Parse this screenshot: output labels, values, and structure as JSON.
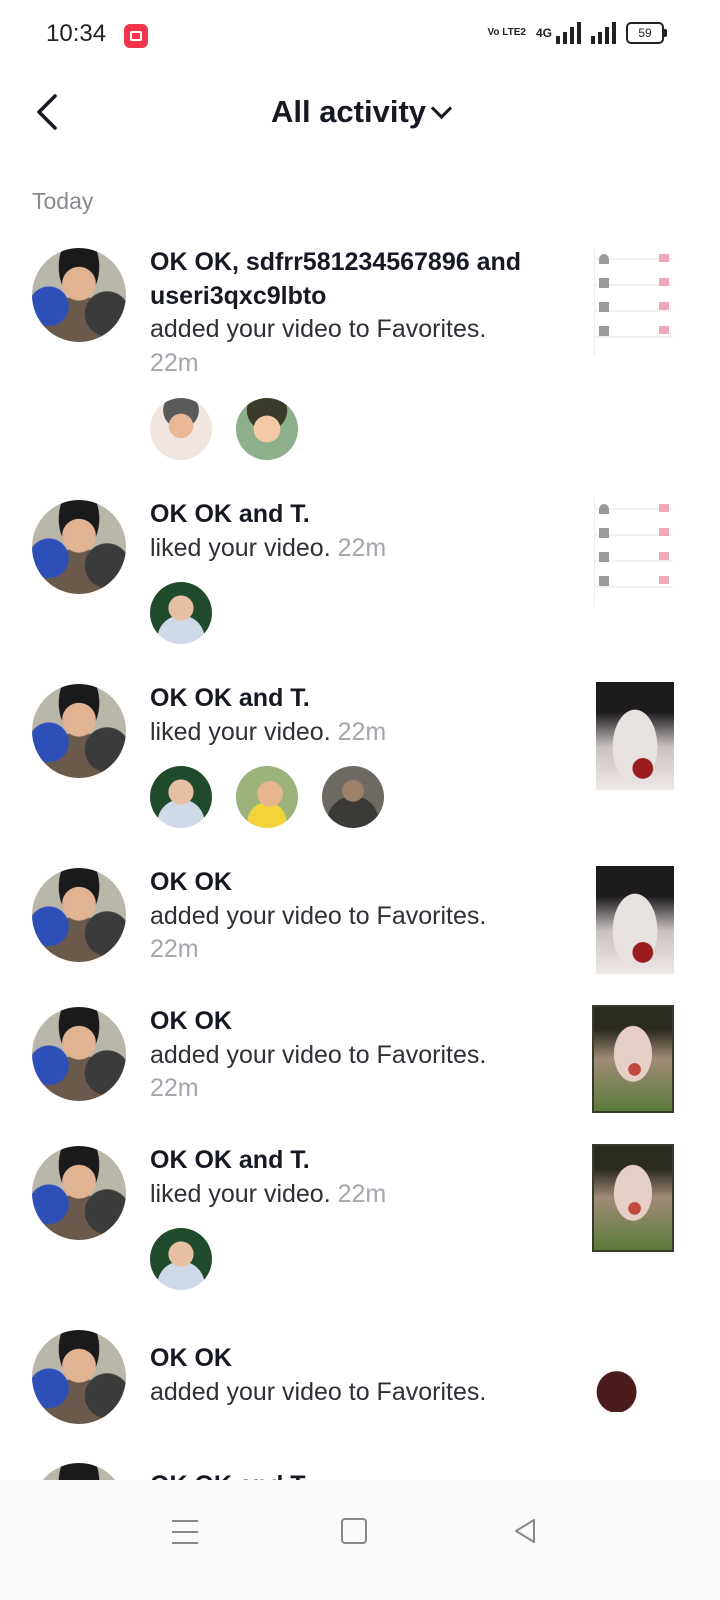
{
  "status_bar": {
    "time": "10:34",
    "volte": "Vo LTE2",
    "network": "4G",
    "battery": "59",
    "icons": [
      "screen-record-icon",
      "volte-icon",
      "signal-icon",
      "signal-icon",
      "battery-icon"
    ]
  },
  "header": {
    "title": "All activity",
    "back_icon": "chevron-left-icon",
    "dropdown_icon": "chevron-down-icon"
  },
  "section": {
    "label": "Today"
  },
  "notifications": [
    {
      "names": "OK OK, sdfrr581234567896 and useri3qxc9lbto",
      "action": "added your video to Favorites.",
      "time": "22m",
      "time_inline": false
    },
    {
      "names": "OK OK and T.",
      "action": "liked your video.",
      "time": "22m",
      "time_inline": true
    },
    {
      "names": "OK OK and T.",
      "action": "liked your video.",
      "time": "22m",
      "time_inline": true
    },
    {
      "names": "OK OK",
      "action": "added your video to Favorites.",
      "time": "22m",
      "time_inline": false
    },
    {
      "names": "OK OK",
      "action": "added your video to Favorites.",
      "time": "22m",
      "time_inline": false
    },
    {
      "names": "OK OK and T.",
      "action": "liked your video.",
      "time": "22m",
      "time_inline": true
    },
    {
      "names": "OK OK",
      "action": "added your video to Favorites.",
      "time": "",
      "time_inline": false
    },
    {
      "names": "OK OK and T.",
      "action": "",
      "time": "",
      "time_inline": false
    }
  ],
  "nav_bar": {
    "icons": [
      "menu-icon",
      "home-square-icon",
      "back-triangle-icon"
    ]
  }
}
